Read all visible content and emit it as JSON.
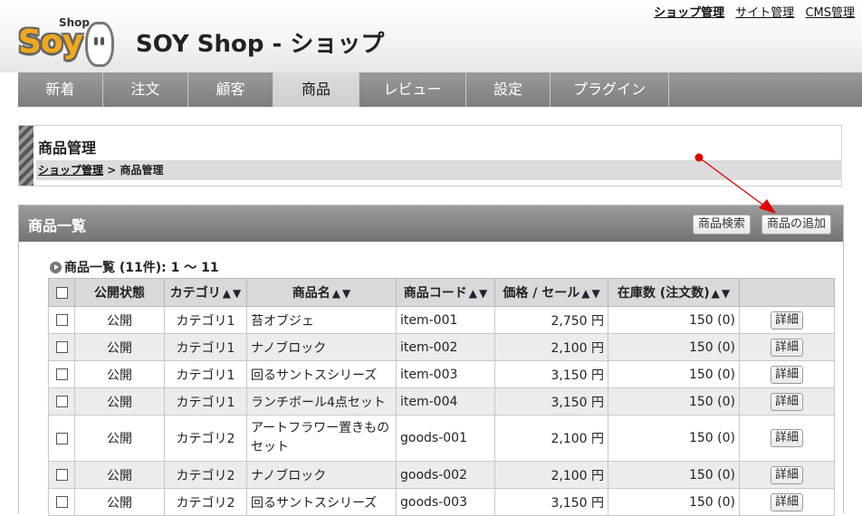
{
  "header": {
    "app_title": "SOY Shop - ショップ",
    "logo_word": "Soy",
    "logo_badge": "Shop",
    "top_links": [
      "ショップ管理",
      "サイト管理",
      "CMS管理"
    ]
  },
  "nav": {
    "items": [
      "新着",
      "注文",
      "顧客",
      "商品",
      "レビュー",
      "設定",
      "プラグイン"
    ],
    "active": "商品"
  },
  "page": {
    "title": "商品管理",
    "breadcrumb_link": "ショップ管理",
    "breadcrumb_sep": " > ",
    "breadcrumb_current": "商品管理"
  },
  "panel": {
    "title": "商品一覧",
    "search_button": "商品検索",
    "add_button": "商品の追加",
    "summary": "商品一覧 (11件): 1 ～ 11"
  },
  "table": {
    "headers": [
      "公開状態",
      "カテゴリ",
      "商品名",
      "商品コード",
      "価格 / セール",
      "在庫数 (注文数)"
    ],
    "sort_asc": "▲",
    "sort_desc": "▼",
    "detail_label": "詳細",
    "rows": [
      {
        "status": "公開",
        "category": "カテゴリ1",
        "name": "苔オブジェ",
        "code": "item-001",
        "price": "2,750 円",
        "stock": "150 (0)"
      },
      {
        "status": "公開",
        "category": "カテゴリ1",
        "name": "ナノブロック",
        "code": "item-002",
        "price": "2,100 円",
        "stock": "150 (0)"
      },
      {
        "status": "公開",
        "category": "カテゴリ1",
        "name": "回るサントスシリーズ",
        "code": "item-003",
        "price": "3,150 円",
        "stock": "150 (0)"
      },
      {
        "status": "公開",
        "category": "カテゴリ1",
        "name": "ランチボール4点セット",
        "code": "item-004",
        "price": "3,150 円",
        "stock": "150 (0)"
      },
      {
        "status": "公開",
        "category": "カテゴリ2",
        "name": "アートフラワー置きもの\nセット",
        "code": "goods-001",
        "price": "2,100 円",
        "stock": "150 (0)"
      },
      {
        "status": "公開",
        "category": "カテゴリ2",
        "name": "ナノブロック",
        "code": "goods-002",
        "price": "2,100 円",
        "stock": "150 (0)"
      },
      {
        "status": "公開",
        "category": "カテゴリ2",
        "name": "回るサントスシリーズ",
        "code": "goods-003",
        "price": "3,150 円",
        "stock": "150 (0)"
      }
    ]
  },
  "colors": {
    "annotation": "#e00000",
    "logo": "#f0a81c"
  }
}
